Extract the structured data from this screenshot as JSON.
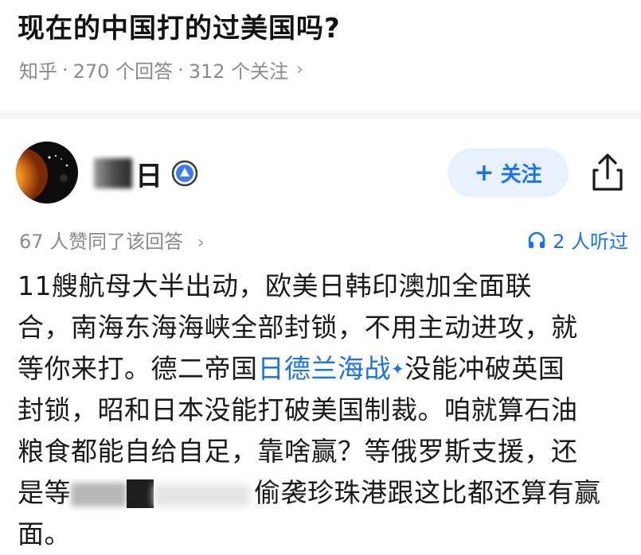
{
  "question": {
    "title": "现在的中国打的过美国吗?",
    "source": "知乎",
    "answers_count": "270 个回答",
    "followers_count": "312 个关注",
    "separator": "·",
    "chevron": "›"
  },
  "author": {
    "name_visible": "日",
    "badge_icon": "verified-badge-icon",
    "avatar_icon": "sun-avatar-icon"
  },
  "actions": {
    "follow_plus": "+",
    "follow_label": "关注",
    "share_icon": "share-icon"
  },
  "stats": {
    "likes": "67 人赞同了该回答",
    "likes_chevron": "›",
    "listened": "2 人听过",
    "listen_icon": "headphones-icon"
  },
  "answer": {
    "line1": "11艘航母大半出动，欧美日韩印澳加全面联",
    "line2": "合，南海东海海峡全部封锁，不用主动进攻，就",
    "line3_pre": "等你来打。德二帝国",
    "line3_link": "日德兰海战",
    "line3_spark": "✦",
    "line3_post": "没能冲破英国",
    "line4": "封锁，昭和日本没能打破美国制裁。咱就算石油",
    "line5": "粮食都能自给自足，靠啥赢？等俄罗斯支援，还",
    "line6_pre": "是等",
    "line6_post": "偷袭珍珠港跟这比都还算有赢",
    "line7": "面。"
  },
  "colors": {
    "accent": "#1772f6",
    "follow_bg": "#e8f1fd",
    "meta_gray": "#8a8a8a",
    "title": "#121212"
  }
}
